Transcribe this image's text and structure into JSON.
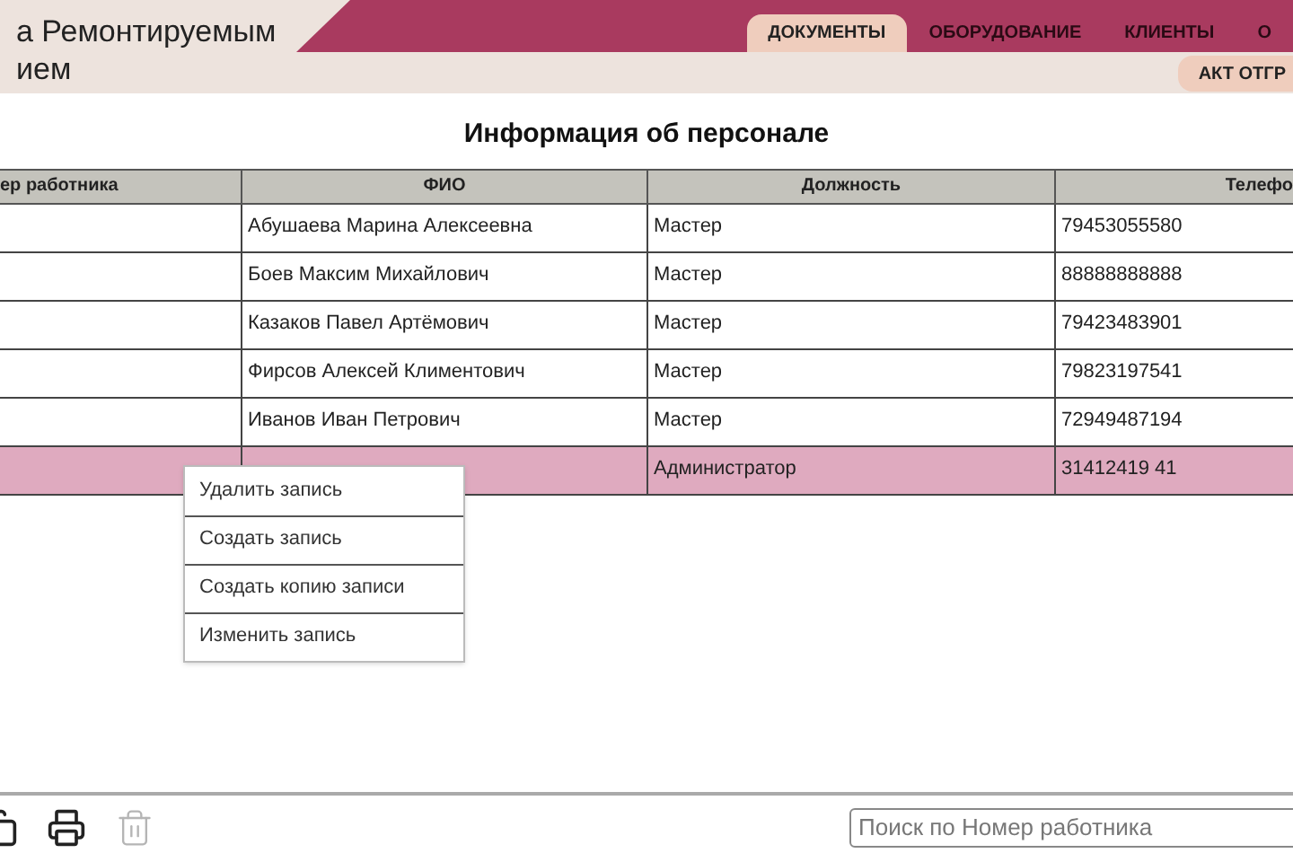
{
  "app_title": {
    "lines": [
      "а Ремонтируемым",
      "ием"
    ]
  },
  "tabs": [
    {
      "label": "ДОКУМЕНТЫ",
      "selected": true
    },
    {
      "label": "ОБОРУДОВАНИЕ",
      "selected": false
    },
    {
      "label": "КЛИЕНТЫ",
      "selected": false
    },
    {
      "label": "О",
      "selected": false
    }
  ],
  "subtab": {
    "label": "АКТ ОТГР"
  },
  "page_title": "Информация об персонале",
  "table": {
    "columns": [
      "ер работника",
      "ФИО",
      "Должность",
      "Телефо"
    ],
    "rows": [
      {
        "cells": [
          "",
          "Абушаева Марина Алексеевна",
          "Мастер",
          "79453055580"
        ],
        "selected": false
      },
      {
        "cells": [
          "",
          "Боев Максим Михайлович",
          "Мастер",
          "88888888888"
        ],
        "selected": false
      },
      {
        "cells": [
          "",
          "Казаков Павел Артёмович",
          "Мастер",
          "79423483901"
        ],
        "selected": false
      },
      {
        "cells": [
          "",
          "Фирсов Алексей Климентович",
          "Мастер",
          "79823197541"
        ],
        "selected": false
      },
      {
        "cells": [
          "",
          "Иванов Иван Петрович",
          "Мастер",
          "72949487194"
        ],
        "selected": false
      },
      {
        "cells": [
          "",
          "",
          "Администратор",
          "31412419 41"
        ],
        "selected": true
      }
    ]
  },
  "context_menu": {
    "items": [
      "Удалить запись",
      "Создать запись",
      "Создать копию записи",
      "Изменить запись"
    ]
  },
  "toolbar": [
    {
      "kind": "copy",
      "disabled": false
    },
    {
      "kind": "print",
      "disabled": false
    },
    {
      "kind": "delete",
      "disabled": true
    }
  ],
  "search": {
    "placeholder": "Поиск по Номер работника"
  }
}
